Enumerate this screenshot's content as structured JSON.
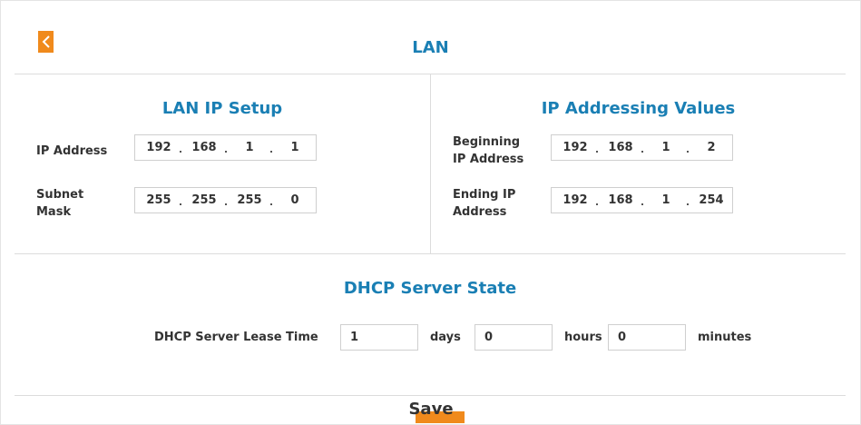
{
  "page": {
    "title": "LAN",
    "accent": "#1a7fb4",
    "button_color": "#f08a1c"
  },
  "lan_ip_setup": {
    "title": "LAN IP Setup",
    "ip_address": {
      "label": "IP Address",
      "octets": [
        "192",
        "168",
        "1",
        "1"
      ]
    },
    "subnet_mask": {
      "label_line1": "Subnet",
      "label_line2": "Mask",
      "octets": [
        "255",
        "255",
        "255",
        "0"
      ]
    }
  },
  "ip_addressing": {
    "title": "IP Addressing Values",
    "beginning": {
      "label_line1": "Beginning",
      "label_line2": "IP Address",
      "octets": [
        "192",
        "168",
        "1",
        "2"
      ]
    },
    "ending": {
      "label_line1": "Ending IP",
      "label_line2": "Address",
      "octets": [
        "192",
        "168",
        "1",
        "254"
      ]
    }
  },
  "dhcp": {
    "title": "DHCP Server State",
    "lease_label": "DHCP Server Lease Time",
    "days_value": "1",
    "days_unit": "days",
    "hours_value": "0",
    "hours_unit": "hours",
    "minutes_value": "0",
    "minutes_unit": "minutes"
  },
  "actions": {
    "save_label": "Save"
  }
}
